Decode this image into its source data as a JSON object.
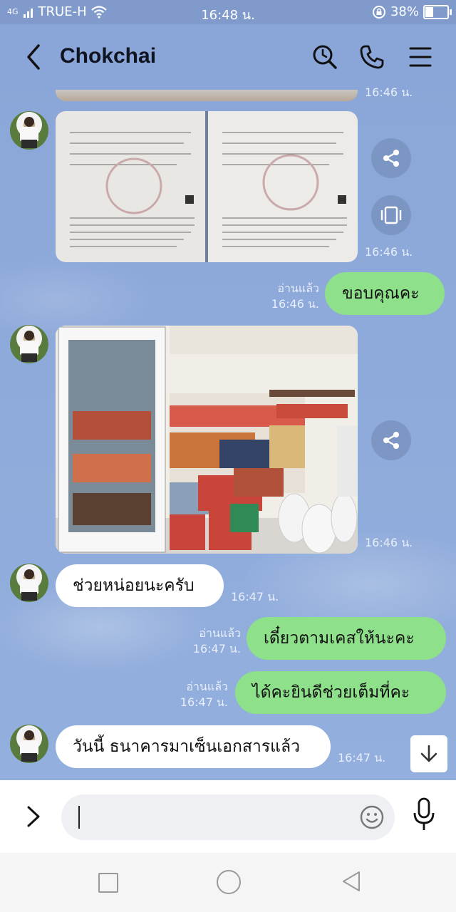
{
  "status_bar": {
    "signal": "4G",
    "carrier": "TRUE-H",
    "time": "16:48 น.",
    "battery_percent": "38%",
    "battery_level": 0.38
  },
  "header": {
    "title": "Chokchai",
    "icons": [
      "back-icon",
      "search-icon",
      "phone-icon",
      "menu-icon"
    ]
  },
  "messages": {
    "prev_time": "16:46 น.",
    "doc_time": "16:46 น.",
    "read1": "อ่านแล้ว",
    "read1_time": "16:46 น.",
    "msg1": "ขอบคุณคะ",
    "shop_time": "16:46 น.",
    "msg2": "ช่วยหน่อยนะครับ",
    "msg2_time": "16:47 น.",
    "read3": "อ่านแล้ว",
    "read3_time": "16:47 น.",
    "msg3": "เดี๋ยวตามเคสให้นะคะ",
    "read4": "อ่านแล้ว",
    "read4_time": "16:47 น.",
    "msg4": "ได้คะยินดีช่วยเต็มที่คะ",
    "msg5": "วันนี้ ธนาคารมาเซ็นเอกสารแล้ว",
    "msg5_time": "16:47 น."
  },
  "colors": {
    "chat_bg": "#8fa9d8",
    "outgoing_bubble": "#8ee08a",
    "incoming_bubble": "#ffffff"
  }
}
